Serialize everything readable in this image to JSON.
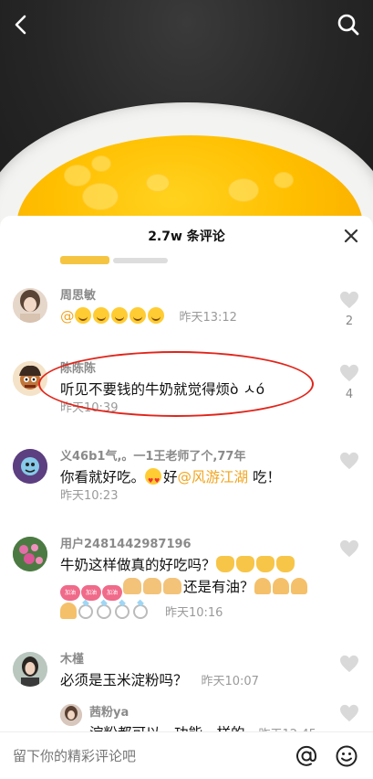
{
  "sheet": {
    "title": "2.7w 条评论"
  },
  "comments": [
    {
      "username": "周思敏",
      "mention": "@",
      "time": "昨天13:12",
      "likes": "2"
    },
    {
      "username": "陈陈陈",
      "text": "听见不要钱的牛奶就觉得烦ò ㅅó",
      "time": "昨天10:39",
      "likes": "4"
    },
    {
      "username": "义46b1气,。一1王老师了个,77年",
      "text_before": "你看就好吃。",
      "text_mid": "好",
      "mention": "@风游江湖",
      "text_after": " 吃！",
      "time": "昨天10:23"
    },
    {
      "username": "用户2481442987196",
      "text_line1": "牛奶这样做真的好吃吗？",
      "text_line2": "还是有油？",
      "badge_text": "加油",
      "time": "昨天10:16"
    },
    {
      "username": "木槿",
      "text": "必须是玉米淀粉吗？",
      "time": "昨天10:07"
    }
  ],
  "reply": {
    "username": "茜粉ya",
    "text": "淀粉都可以，功能一样的",
    "time": "昨天12:45"
  },
  "input": {
    "placeholder": "留下你的精彩评论吧"
  },
  "colors": {
    "mention": "#f2a51f",
    "highlight": "#e0251b"
  }
}
